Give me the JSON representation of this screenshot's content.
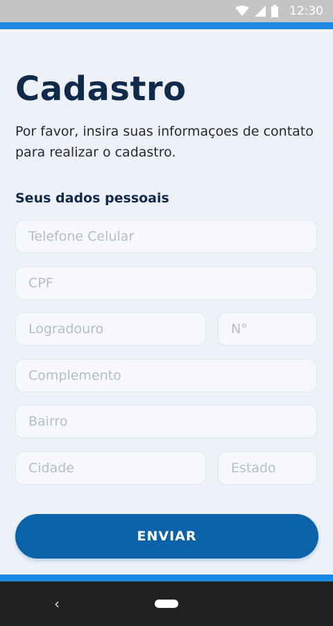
{
  "status_bar": {
    "time": "12:30",
    "icons": [
      "wifi-icon",
      "cell-signal-icon",
      "battery-icon"
    ]
  },
  "form": {
    "title": "Cadastro",
    "subtitle": "Por favor, insira suas informaçoes de contato para realizar o cadastro.",
    "section_title": "Seus dados pessoais",
    "fields": {
      "phone": {
        "placeholder": "Telefone Celular",
        "value": ""
      },
      "cpf": {
        "placeholder": "CPF",
        "value": ""
      },
      "street": {
        "placeholder": "Logradouro",
        "value": ""
      },
      "number": {
        "placeholder": "N°",
        "value": ""
      },
      "complement": {
        "placeholder": "Complemento",
        "value": ""
      },
      "neighborhood": {
        "placeholder": "Bairro",
        "value": ""
      },
      "city": {
        "placeholder": "Cidade",
        "value": ""
      },
      "state": {
        "placeholder": "Estado",
        "value": ""
      }
    },
    "submit_label": "ENVIAR"
  },
  "nav_bar": {
    "back_glyph": "‹",
    "icons": [
      "back-icon",
      "home-pill-icon"
    ]
  },
  "colors": {
    "accent_stripe": "#1e88e5",
    "button": "#0a63a8",
    "title": "#0f2a4a",
    "background": "#eef1f8"
  }
}
